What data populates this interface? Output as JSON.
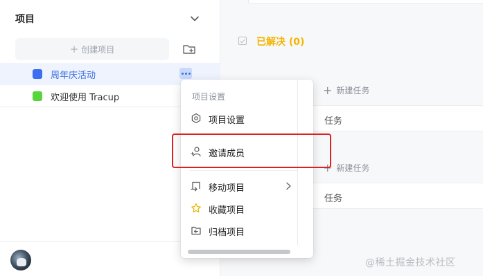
{
  "sidebar": {
    "title": "项目",
    "create_label": "创建项目",
    "projects": [
      {
        "name": "周年庆活动",
        "color": "#3b6ff0",
        "active": true
      },
      {
        "name": "欢迎使用 Tracup",
        "color": "#5ad43b",
        "active": false
      }
    ]
  },
  "main": {
    "resolved_title": "已解决 (0)",
    "new_task_label": "新建任务",
    "task_partial": "任务"
  },
  "context_menu": {
    "heading": "项目设置",
    "items": [
      {
        "label": "项目设置",
        "icon": "gear-icon"
      },
      {
        "label": "邀请成员",
        "icon": "user-add-icon"
      },
      {
        "label": "移动项目",
        "icon": "move-icon",
        "submenu": true
      },
      {
        "label": "收藏项目",
        "icon": "star-icon"
      },
      {
        "label": "归档项目",
        "icon": "archive-icon"
      }
    ]
  },
  "watermark": "@稀土掘金技术社区",
  "colors": {
    "accent": "#3b6fe0",
    "resolved": "#f5b400",
    "highlight": "#e02020"
  }
}
